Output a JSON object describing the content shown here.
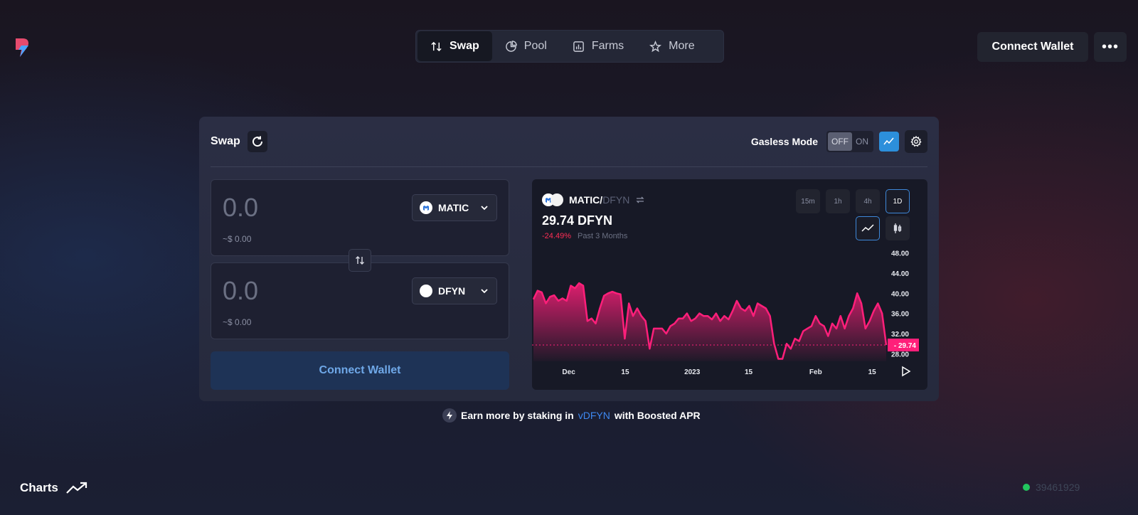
{
  "nav": {
    "items": [
      {
        "label": "Swap",
        "icon": "swap-vertical-icon",
        "active": true
      },
      {
        "label": "Pool",
        "icon": "pie-chart-icon",
        "active": false
      },
      {
        "label": "Farms",
        "icon": "bar-chart-icon",
        "active": false
      },
      {
        "label": "More",
        "icon": "star-icon",
        "active": false
      }
    ]
  },
  "header": {
    "connect_wallet": "Connect Wallet",
    "more_menu": "•••"
  },
  "swap": {
    "title": "Swap",
    "gasless_label": "Gasless Mode",
    "toggle_off": "OFF",
    "toggle_on": "ON",
    "from": {
      "amount": "0.0",
      "usd": "~$ 0.00",
      "token": "MATIC"
    },
    "to": {
      "amount": "0.0",
      "usd": "~$ 0.00",
      "token": "DFYN"
    },
    "connect_wallet": "Connect Wallet"
  },
  "chart_panel": {
    "base": "MATIC/",
    "quote": "DFYN",
    "price": "29.74 DFYN",
    "change": "-24.49%",
    "period": "Past 3 Months",
    "timeframes": [
      "15m",
      "1h",
      "4h",
      "1D"
    ],
    "active_timeframe": "1D"
  },
  "chart_data": {
    "type": "area",
    "series": [
      {
        "values": [
          38.8,
          40.5,
          40.2,
          38.0,
          39.3,
          39.6,
          38.5,
          39.0,
          38.5,
          41.5,
          41.0,
          42.0,
          41.5,
          34.5,
          35.0,
          34.0,
          37.0,
          39.5,
          40.0,
          40.3,
          40.0,
          39.8,
          31.0,
          38.0,
          35.5,
          37.0,
          35.5,
          34.5,
          29.0,
          33.0,
          33.0,
          33.0,
          32.0,
          33.5,
          34.0,
          35.0,
          35.0,
          36.0,
          34.5,
          35.0,
          36.0,
          35.5,
          35.5,
          34.8,
          36.0,
          34.5,
          35.5,
          34.8,
          36.5,
          38.5,
          37.0,
          36.5,
          37.5,
          35.5,
          38.0,
          37.5,
          37.0,
          35.5,
          30.0,
          27.0,
          27.0,
          30.0,
          29.0,
          31.0,
          30.5,
          32.5,
          33.0,
          33.5,
          35.5,
          34.0,
          33.5,
          31.5,
          34.0,
          33.0,
          35.5,
          33.0,
          35.5,
          37.0,
          40.0,
          38.0,
          33.0,
          34.5,
          36.5,
          38.0,
          36.0,
          29.74
        ],
        "color": "#ff1f7a"
      }
    ],
    "x_ticks": [
      "Dec",
      "15",
      "2023",
      "15",
      "Feb",
      "15"
    ],
    "y_ticks": [
      "48.00",
      "44.00",
      "40.00",
      "36.00",
      "32.00",
      "28.00"
    ],
    "ylim": [
      26.5,
      48.5
    ],
    "last_value_label": "29.74",
    "last_value_color": "#ff1f7a",
    "grid": false
  },
  "earn": {
    "text_before": "Earn more by staking in",
    "link": "vDFYN",
    "text_after": "with Boosted APR"
  },
  "footer": {
    "charts_label": "Charts",
    "block_number": "39461929"
  }
}
